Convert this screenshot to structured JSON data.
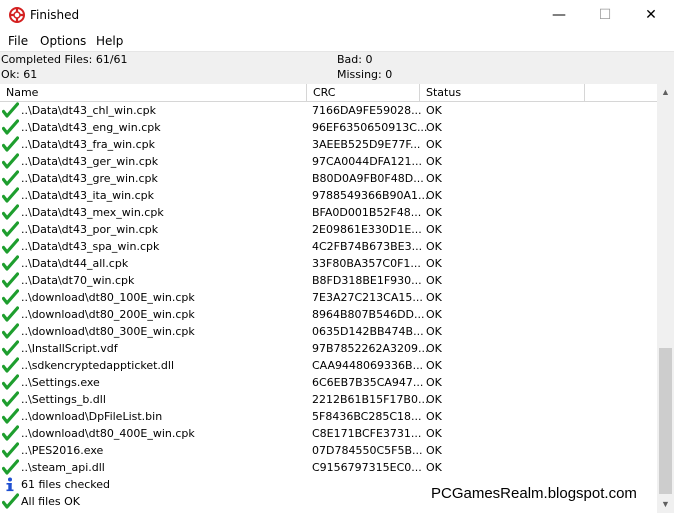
{
  "window": {
    "title": "Finished",
    "minimize": "—",
    "maximize": "☐",
    "close": "✕"
  },
  "menu": [
    {
      "label": "File"
    },
    {
      "label": "Options"
    },
    {
      "label": "Help"
    }
  ],
  "summary": {
    "completed": "Completed Files: 61/61",
    "bad": "Bad: 0",
    "ok": "Ok: 61",
    "missing": "Missing: 0"
  },
  "columns": {
    "name": "Name",
    "crc": "CRC",
    "status": "Status"
  },
  "rows": [
    {
      "icon": "check",
      "name": "..\\Data\\dt43_chl_win.cpk",
      "crc": "7166DA9FE59028...",
      "status": "OK"
    },
    {
      "icon": "check",
      "name": "..\\Data\\dt43_eng_win.cpk",
      "crc": "96EF6350650913C...",
      "status": "OK"
    },
    {
      "icon": "check",
      "name": "..\\Data\\dt43_fra_win.cpk",
      "crc": "3AEEB525D9E77F...",
      "status": "OK"
    },
    {
      "icon": "check",
      "name": "..\\Data\\dt43_ger_win.cpk",
      "crc": "97CA0044DFA121...",
      "status": "OK"
    },
    {
      "icon": "check",
      "name": "..\\Data\\dt43_gre_win.cpk",
      "crc": "B80D0A9FB0F48D...",
      "status": "OK"
    },
    {
      "icon": "check",
      "name": "..\\Data\\dt43_ita_win.cpk",
      "crc": "9788549366B90A1...",
      "status": "OK"
    },
    {
      "icon": "check",
      "name": "..\\Data\\dt43_mex_win.cpk",
      "crc": "BFA0D001B52F48...",
      "status": "OK"
    },
    {
      "icon": "check",
      "name": "..\\Data\\dt43_por_win.cpk",
      "crc": "2E09861E330D1E...",
      "status": "OK"
    },
    {
      "icon": "check",
      "name": "..\\Data\\dt43_spa_win.cpk",
      "crc": "4C2FB74B673BE3...",
      "status": "OK"
    },
    {
      "icon": "check",
      "name": "..\\Data\\dt44_all.cpk",
      "crc": "33F80BA357C0F1...",
      "status": "OK"
    },
    {
      "icon": "check",
      "name": "..\\Data\\dt70_win.cpk",
      "crc": "B8FD318BE1F930...",
      "status": "OK"
    },
    {
      "icon": "check",
      "name": "..\\download\\dt80_100E_win.cpk",
      "crc": "7E3A27C213CA15...",
      "status": "OK"
    },
    {
      "icon": "check",
      "name": "..\\download\\dt80_200E_win.cpk",
      "crc": "8964B807B546DD...",
      "status": "OK"
    },
    {
      "icon": "check",
      "name": "..\\download\\dt80_300E_win.cpk",
      "crc": "0635D142BB474B...",
      "status": "OK"
    },
    {
      "icon": "check",
      "name": "..\\InstallScript.vdf",
      "crc": "97B7852262A3209...",
      "status": "OK"
    },
    {
      "icon": "check",
      "name": "..\\sdkencryptedappticket.dll",
      "crc": "CAA9448069336B...",
      "status": "OK"
    },
    {
      "icon": "check",
      "name": "..\\Settings.exe",
      "crc": "6C6EB7B35CA947...",
      "status": "OK"
    },
    {
      "icon": "check",
      "name": "..\\Settings_b.dll",
      "crc": "2212B61B15F17B0...",
      "status": "OK"
    },
    {
      "icon": "check",
      "name": "..\\download\\DpFileList.bin",
      "crc": "5F8436BC285C18...",
      "status": "OK"
    },
    {
      "icon": "check",
      "name": "..\\download\\dt80_400E_win.cpk",
      "crc": "C8E171BCFE3731...",
      "status": "OK"
    },
    {
      "icon": "check",
      "name": "..\\PES2016.exe",
      "crc": "07D784550C5F5B...",
      "status": "OK"
    },
    {
      "icon": "check",
      "name": "..\\steam_api.dll",
      "crc": "C9156797315EC0...",
      "status": "OK"
    },
    {
      "icon": "info",
      "name": "61 files checked",
      "crc": "",
      "status": ""
    },
    {
      "icon": "check",
      "name": "All files OK",
      "crc": "",
      "status": ""
    }
  ],
  "watermark": "PCGamesRealm.blogspot.com",
  "colors": {
    "check": "#1e9e2e",
    "info": "#1f4fd1",
    "app_icon": "#d42020"
  }
}
